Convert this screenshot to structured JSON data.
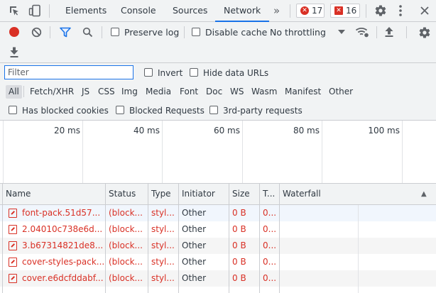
{
  "tabs": {
    "items": [
      "Elements",
      "Console",
      "Sources",
      "Network"
    ],
    "more": "»",
    "errors_count": "17",
    "issues_count": "16"
  },
  "toolbar": {
    "preserve_log": "Preserve log",
    "disable_cache": "Disable cache",
    "throttling": "No throttling"
  },
  "filter": {
    "placeholder": "Filter",
    "invert": "Invert",
    "hide_data_urls": "Hide data URLs"
  },
  "types": [
    "All",
    "Fetch/XHR",
    "JS",
    "CSS",
    "Img",
    "Media",
    "Font",
    "Doc",
    "WS",
    "Wasm",
    "Manifest",
    "Other"
  ],
  "blocked": {
    "has_blocked_cookies": "Has blocked cookies",
    "blocked_requests": "Blocked Requests",
    "third_party": "3rd-party requests"
  },
  "overview": {
    "ticks": [
      "20 ms",
      "40 ms",
      "60 ms",
      "80 ms",
      "100 ms"
    ]
  },
  "table": {
    "headers": {
      "name": "Name",
      "status": "Status",
      "type": "Type",
      "initiator": "Initiator",
      "size": "Size",
      "time": "T...",
      "waterfall": "Waterfall",
      "sort": "▲"
    },
    "rows": [
      {
        "name": "font-pack.51d57...",
        "status": "(block...",
        "type": "styl...",
        "initiator": "Other",
        "size": "0 B",
        "time": "0..."
      },
      {
        "name": "2.04010c738e6d...",
        "status": "(block...",
        "type": "styl...",
        "initiator": "Other",
        "size": "0 B",
        "time": "0..."
      },
      {
        "name": "3.b67314821de8...",
        "status": "(block...",
        "type": "styl...",
        "initiator": "Other",
        "size": "0 B",
        "time": "0..."
      },
      {
        "name": "cover-styles-pack...",
        "status": "(block...",
        "type": "styl...",
        "initiator": "Other",
        "size": "0 B",
        "time": "0..."
      },
      {
        "name": "cover.e6dcfddabf...",
        "status": "(block...",
        "type": "styl...",
        "initiator": "Other",
        "size": "0 B",
        "time": "0..."
      }
    ]
  },
  "colors": {
    "accent": "#1a73e8",
    "error": "#d93025",
    "record": "#d93025"
  }
}
